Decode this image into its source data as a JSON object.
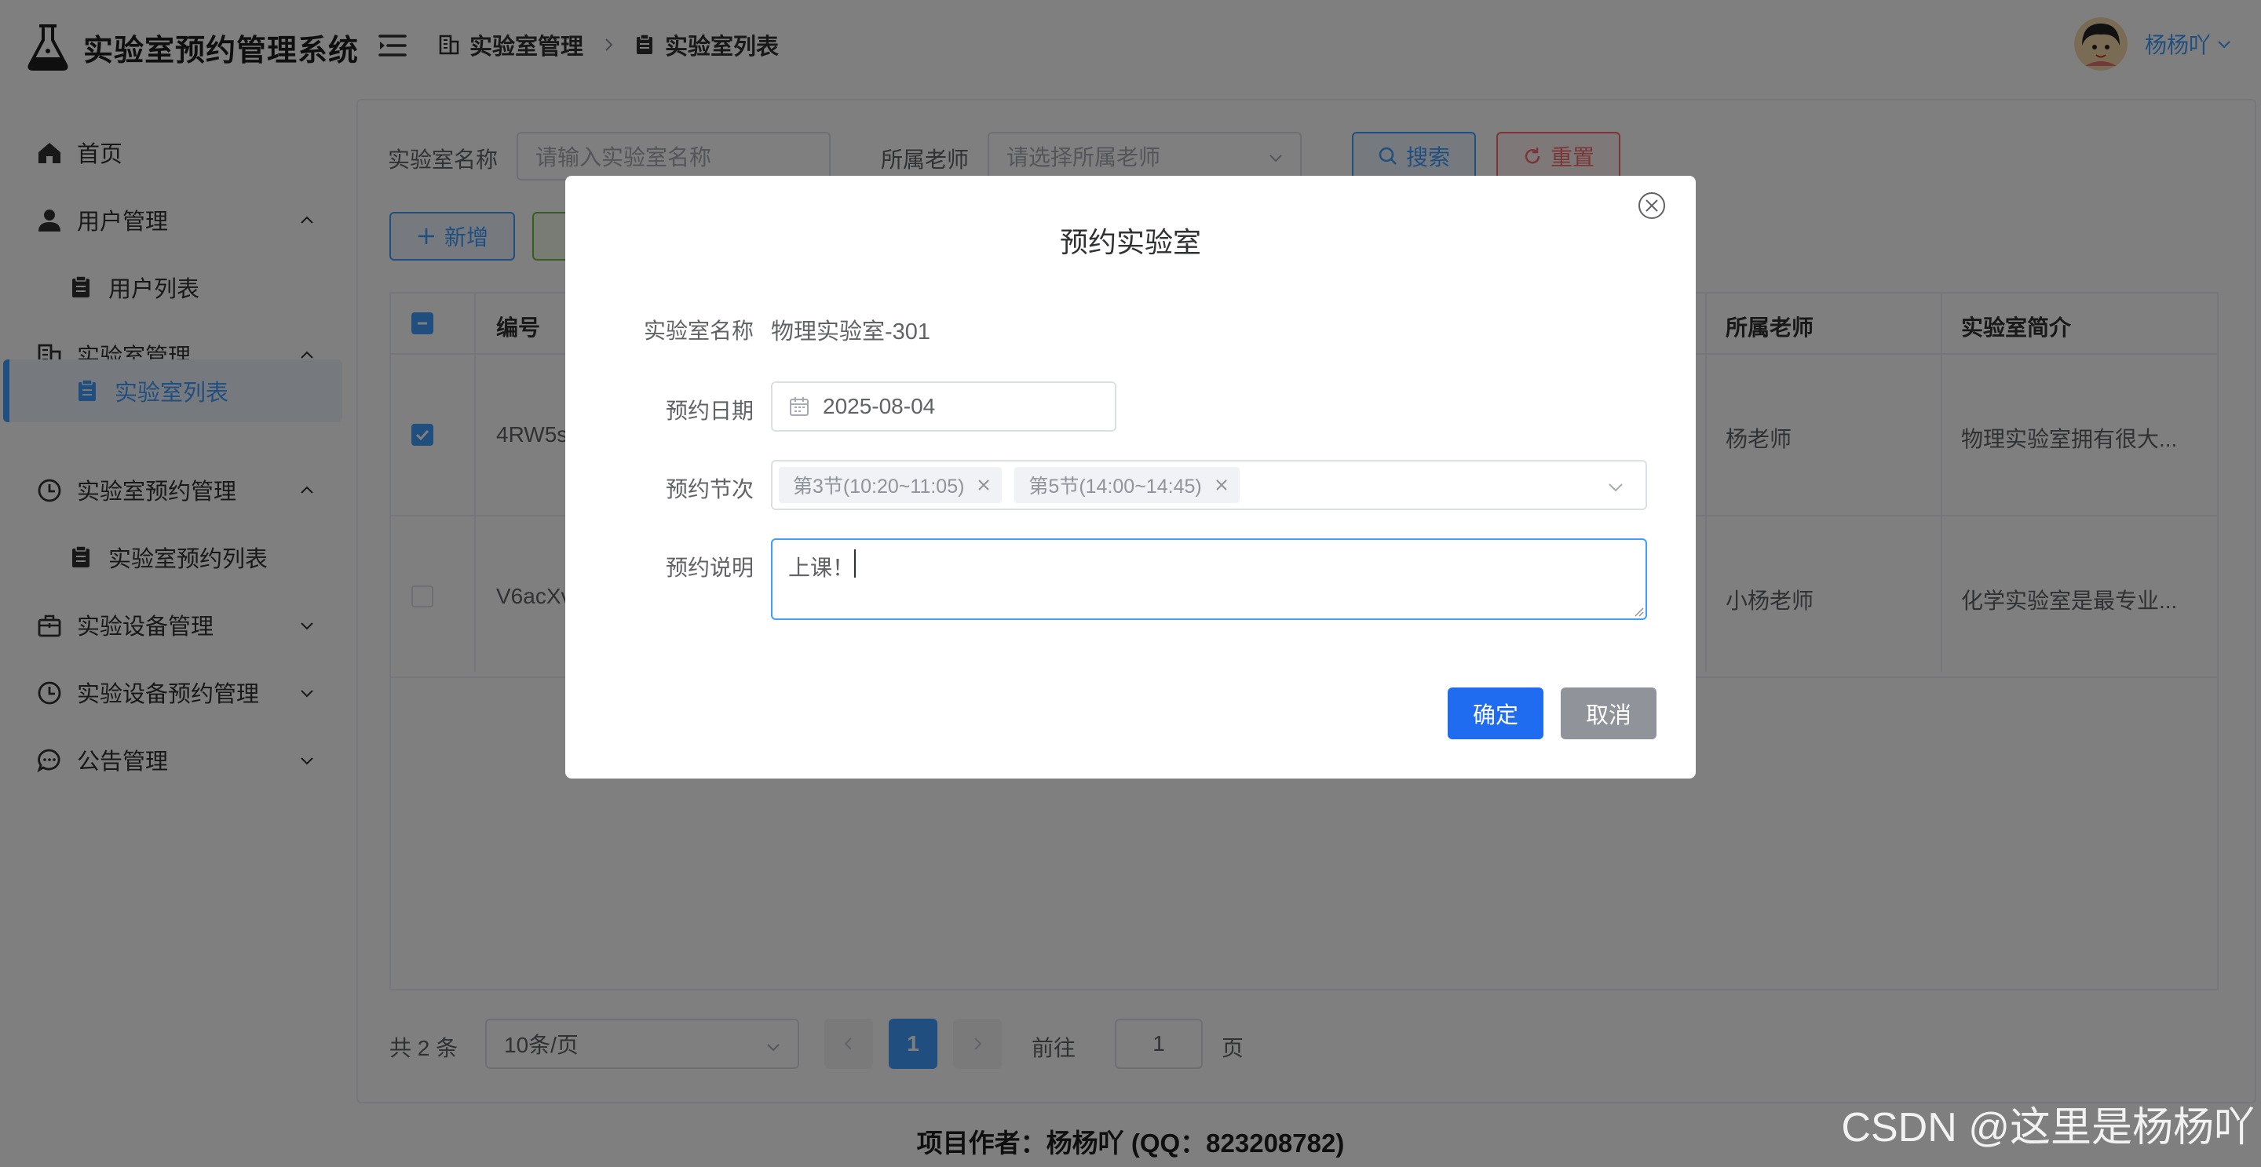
{
  "header": {
    "app_title": "实验室预约管理系统",
    "breadcrumb": [
      "实验室管理",
      "实验室列表"
    ],
    "user_name": "杨杨吖"
  },
  "sidebar": {
    "items": [
      {
        "label": "首页",
        "icon": "home-icon"
      },
      {
        "label": "用户管理",
        "icon": "user-icon",
        "expanded": true
      },
      {
        "label": "用户列表",
        "icon": "clipboard-icon",
        "sub": true
      },
      {
        "label": "实验室管理",
        "icon": "building-icon",
        "expanded": true
      },
      {
        "label": "实验室列表",
        "icon": "clipboard-icon",
        "sub": true,
        "active": true
      },
      {
        "label": "实验室预约管理",
        "icon": "clock-icon",
        "expanded": true
      },
      {
        "label": "实验室预约列表",
        "icon": "clipboard-icon",
        "sub": true
      },
      {
        "label": "实验设备管理",
        "icon": "briefcase-icon",
        "expanded": false
      },
      {
        "label": "实验设备预约管理",
        "icon": "clock-icon",
        "expanded": false
      },
      {
        "label": "公告管理",
        "icon": "chat-icon",
        "expanded": false
      }
    ]
  },
  "filters": {
    "lab_name_label": "实验室名称",
    "lab_name_placeholder": "请输入实验室名称",
    "teacher_label": "所属老师",
    "teacher_placeholder": "请选择所属老师",
    "search_label": "搜索",
    "reset_label": "重置",
    "add_label": "新增"
  },
  "table": {
    "headers": {
      "id": "编号",
      "teacher": "所属老师",
      "intro": "实验室简介"
    },
    "rows": [
      {
        "id": "4RW5s",
        "teacher": "杨老师",
        "intro": "物理实验室拥有很大...",
        "checked": true
      },
      {
        "id": "V6acXv",
        "teacher": "小杨老师",
        "intro": "化学实验室是最专业...",
        "checked": false
      }
    ]
  },
  "pager": {
    "total": "共 2 条",
    "page_size": "10条/页",
    "current": "1",
    "goto_label": "前往",
    "goto_value": "1",
    "page_unit": "页"
  },
  "footer": "项目作者：杨杨吖 (QQ：823208782)",
  "watermark": "CSDN @这里是杨杨吖",
  "dialog": {
    "title": "预约实验室",
    "lab_name_label": "实验室名称",
    "lab_name_value": "物理实验室-301",
    "date_label": "预约日期",
    "date_value": "2025-08-04",
    "session_label": "预约节次",
    "sessions": [
      "第3节(10:20~11:05)",
      "第5节(14:00~14:45)"
    ],
    "note_label": "预约说明",
    "note_value": "上课！",
    "confirm_label": "确定",
    "cancel_label": "取消"
  },
  "colors": {
    "primary": "#409eff",
    "confirm": "#1f6cf0",
    "danger": "#f56c6c",
    "success": "#67c23a",
    "muted": "#909399"
  }
}
